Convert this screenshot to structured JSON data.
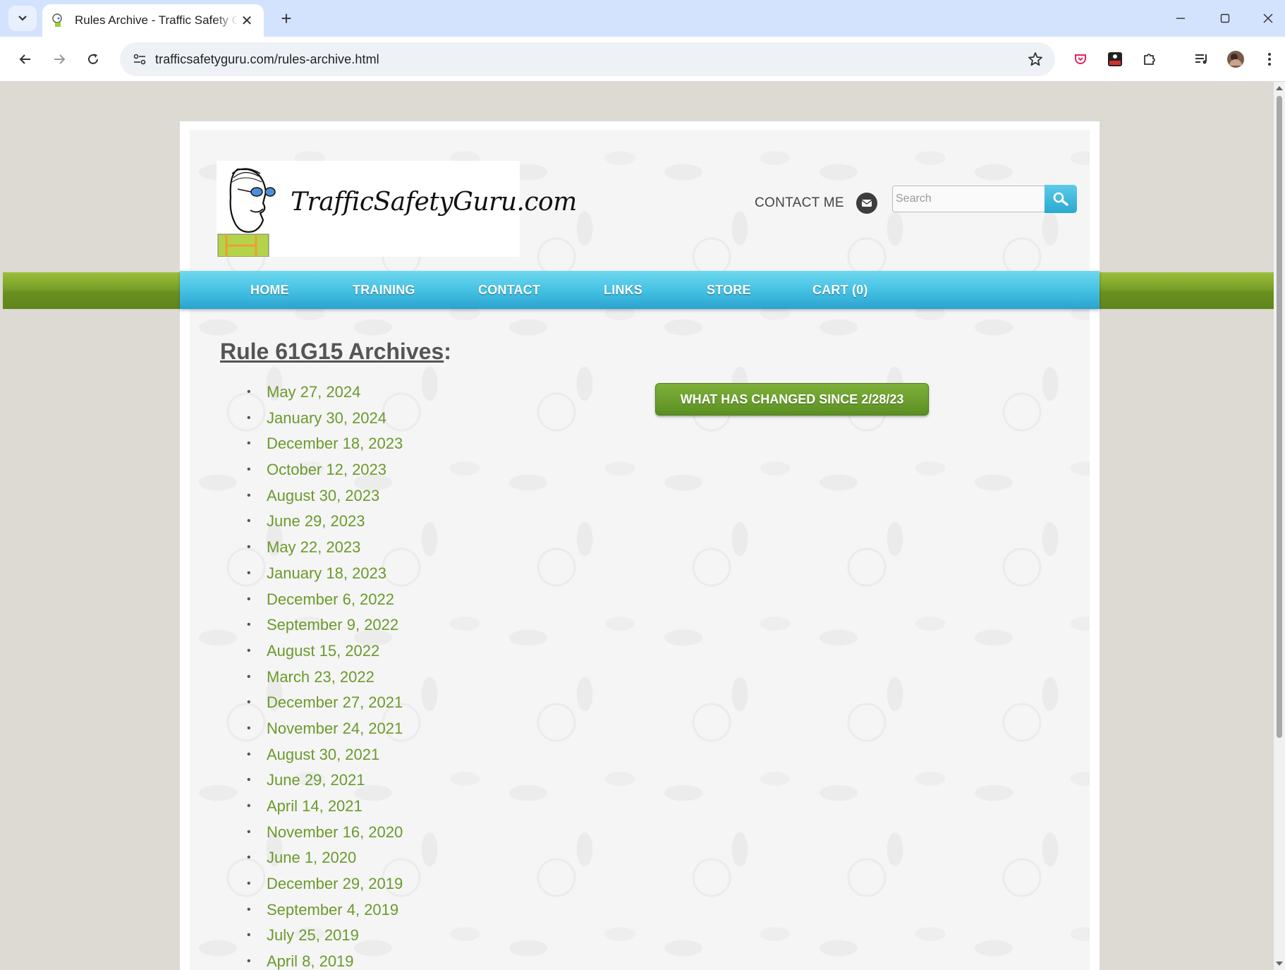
{
  "browser": {
    "tab_title": "Rules Archive - Traffic Safety Guru",
    "url": "trafficsafetyguru.com/rules-archive.html"
  },
  "site": {
    "logo_text": "TrafficSafetyGuru.com",
    "contact_me": "CONTACT ME",
    "search_placeholder": "Search"
  },
  "nav": [
    "HOME",
    "TRAINING",
    "CONTACT",
    "LINKS",
    "STORE",
    "CART (0)"
  ],
  "main": {
    "heading_link": "Rule 61G15 Archives",
    "heading_suffix": ":",
    "changed_button": "WHAT HAS CHANGED SINCE 2/28/23",
    "archives": [
      "May 27, 2024",
      "January 30, 2024",
      "December 18, 2023",
      "October 12, 2023",
      "August 30, 2023",
      "June 29, 2023",
      "May 22, 2023",
      "January 18, 2023",
      "December 6, 2022",
      "September 9, 2022",
      "August 15, 2022",
      "March 23, 2022",
      "December 27, 2021",
      "November 24, 2021",
      "August 30, 2021",
      "June 29, 2021",
      "April 14, 2021",
      "November 16, 2020",
      "June 1, 2020",
      "December 29, 2019",
      "September 4, 2019",
      "July 25, 2019",
      "April 8, 2019"
    ]
  },
  "colors": {
    "link_green": "#6b9a2c",
    "nav_blue": "#46c2e4",
    "bar_green": "#78a027"
  }
}
